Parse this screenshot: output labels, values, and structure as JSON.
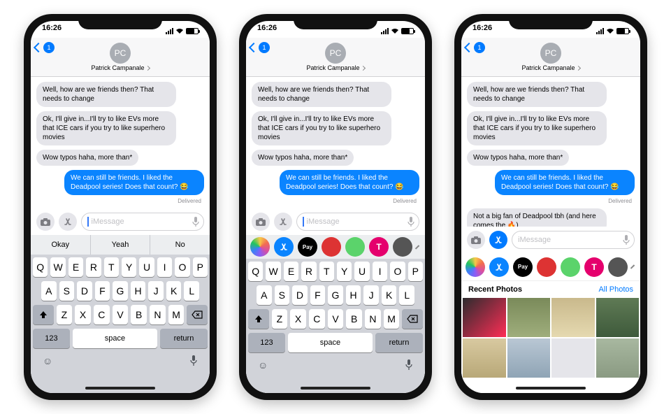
{
  "status": {
    "time": "16:26"
  },
  "header": {
    "back_badge": "1",
    "initials": "PC",
    "name": "Patrick Campanale"
  },
  "msgs": {
    "m1": "Well, how are we friends then? That needs to change",
    "m2": "Ok, I'll give in...I'll try to like EVs more that ICE cars if you try to like superhero movies",
    "m3": "Wow typos haha, more than*",
    "m4": "We can still be friends. I liked the Deadpool series! Does that count? 😂",
    "m5": "Not a big fan of Deadpool tbh (and here comes the 🔥)",
    "delivered": "Delivered"
  },
  "input": {
    "placeholder": "iMessage"
  },
  "suggest": {
    "s1": "Okay",
    "s2": "Yeah",
    "s3": "No"
  },
  "keys": {
    "r1": [
      "Q",
      "W",
      "E",
      "R",
      "T",
      "Y",
      "U",
      "I",
      "O",
      "P"
    ],
    "r2": [
      "A",
      "S",
      "D",
      "F",
      "G",
      "H",
      "J",
      "K",
      "L"
    ],
    "r3": [
      "Z",
      "X",
      "C",
      "V",
      "B",
      "N",
      "M"
    ],
    "num": "123",
    "space": "space",
    "ret": "return"
  },
  "apps": {
    "pay": "Pay",
    "tm": "T"
  },
  "tray": {
    "recent": "Recent Photos",
    "all": "All Photos"
  }
}
